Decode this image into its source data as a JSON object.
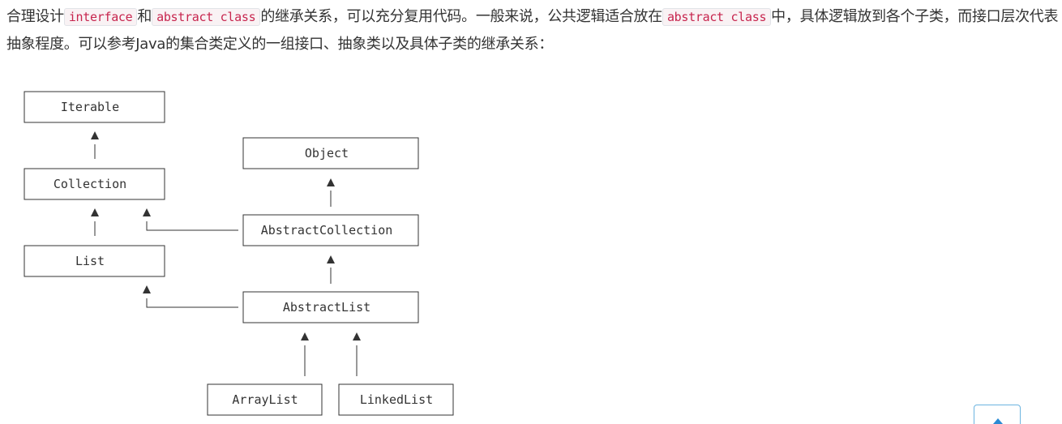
{
  "paragraph": {
    "t1": "合理设计",
    "code1": "interface",
    "t2": "和",
    "code2": "abstract class",
    "t3": "的继承关系，可以充分复用代码。一般来说，公共逻辑适合放在",
    "code3": "abstract class",
    "t4": "中，具体逻辑放到各个子类，而接口层次代表抽象程度。可以参考Java的集合类定义的一组接口、抽象类以及具体子类的继承关系："
  },
  "diagram": {
    "nodes": {
      "iterable": "Iterable",
      "collection": "Collection",
      "list": "List",
      "object": "Object",
      "abstract_collection": "AbstractCollection",
      "abstract_list": "AbstractList",
      "array_list": "ArrayList",
      "linked_list": "LinkedList"
    }
  },
  "scroll_top": {
    "icon": "arrow-up-icon"
  }
}
